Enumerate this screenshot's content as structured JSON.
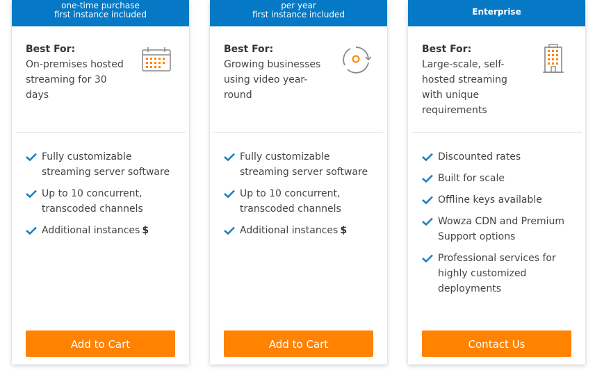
{
  "cards": [
    {
      "header": {
        "line1": "one-time purchase",
        "line2": "first instance included"
      },
      "best_for_label": "Best For:",
      "best_for_text": "On-premises hosted streaming for 30 days",
      "icon": "calendar-icon",
      "features": [
        "Fully customizable streaming server software",
        "Up to 10 concurrent, transcoded channels",
        "Additional instances"
      ],
      "dollar": "$",
      "button": "Add to Cart"
    },
    {
      "header": {
        "line1": "per year",
        "line2": "first instance included"
      },
      "best_for_label": "Best For:",
      "best_for_text": "Growing businesses using video year-round",
      "icon": "refresh-cycle-icon",
      "features": [
        "Fully customizable streaming server software",
        "Up to 10 concurrent, transcoded channels",
        "Additional instances"
      ],
      "dollar": "$",
      "button": "Add to Cart"
    },
    {
      "header": {
        "title": "Enterprise"
      },
      "best_for_label": "Best For:",
      "best_for_text": "Large-scale, self-hosted streaming with unique requirements",
      "icon": "building-icon",
      "features": [
        "Discounted rates",
        "Built for scale",
        "Offline keys available",
        "Wowza CDN and Premium Support options",
        "Professional services for highly customized deployments"
      ],
      "button": "Contact Us"
    }
  ],
  "colors": {
    "header_blue": "#0579c6",
    "cta_orange": "#ff8200",
    "check_blue": "#1a7fc4"
  }
}
